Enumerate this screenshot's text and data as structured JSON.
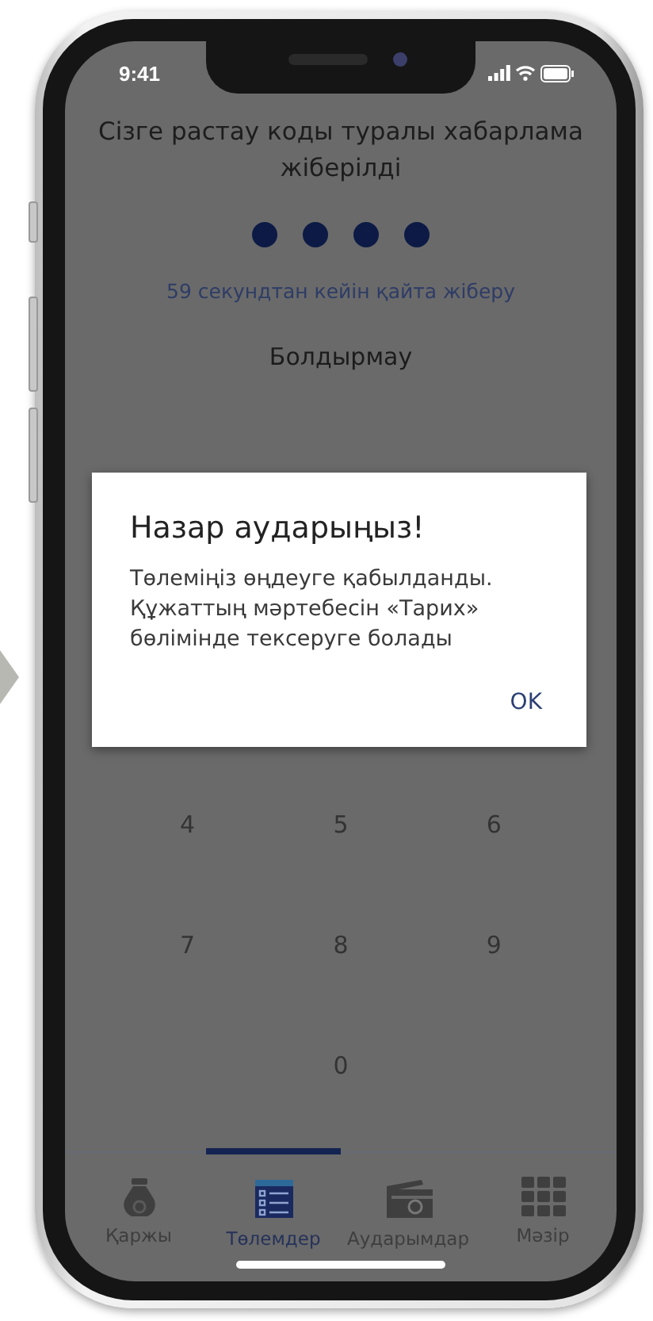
{
  "status_bar": {
    "time": "9:41"
  },
  "verification": {
    "message": "Сізге растау коды туралы хабарлама жіберілді",
    "code_dots": [
      {
        "filled": true
      },
      {
        "filled": true
      },
      {
        "filled": true
      },
      {
        "filled": true
      }
    ],
    "resend": "59 секундтан кейін қайта жіберу",
    "cancel": "Болдырмау"
  },
  "keypad": {
    "rows": [
      [
        "4",
        "5",
        "6"
      ],
      [
        "7",
        "8",
        "9"
      ],
      [
        "",
        "0",
        ""
      ]
    ]
  },
  "dialog": {
    "title": "Назар аударыңыз!",
    "message": "Төлеміңіз өңдеуге қабылданды. Құжаттың мәртебесін «Тарих» бөлімінде тексеруге болады",
    "button": "OK"
  },
  "tabs": [
    {
      "label": "Қаржы",
      "kind": "bag",
      "selected": false
    },
    {
      "label": "Төлемдер",
      "kind": "list",
      "selected": true
    },
    {
      "label": "Аударымдар",
      "kind": "wallet",
      "selected": false
    },
    {
      "label": "Мәзір",
      "kind": "grid",
      "selected": false
    }
  ]
}
